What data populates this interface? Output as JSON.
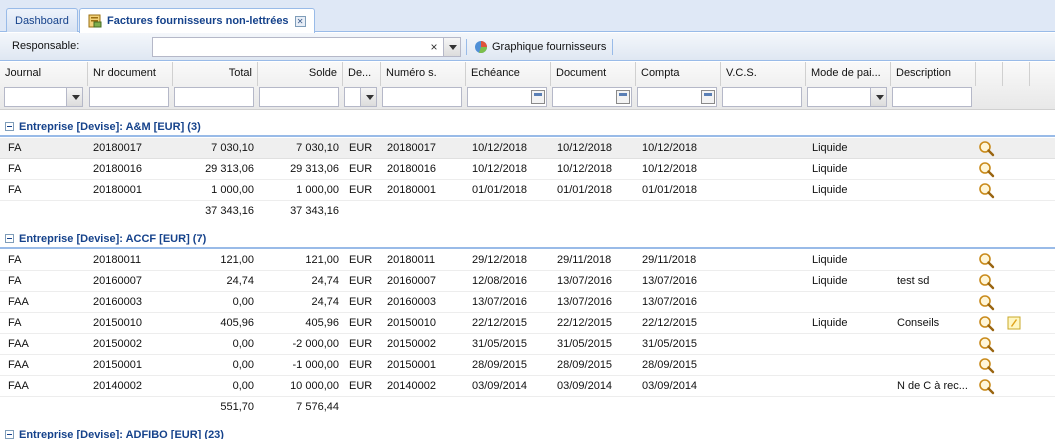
{
  "tabs": [
    {
      "label": "Dashboard",
      "active": false
    },
    {
      "label": "Factures fournisseurs non-lettrées",
      "active": true
    }
  ],
  "toolbar": {
    "responsable_label": "Responsable:",
    "responsable_value": "",
    "clear_glyph": "×",
    "graph_button_label": "Graphique fournisseurs"
  },
  "columns": [
    "Journal",
    "Nr document",
    "Total",
    "Solde",
    "De...",
    "Numéro s.",
    "Echéance",
    "Document",
    "Compta",
    "V.C.S.",
    "Mode de pai...",
    "Description"
  ],
  "groups": [
    {
      "label": "Entreprise [Devise]: A&M [EUR] (3)",
      "rows": [
        {
          "journal": "FA",
          "nr": "20180017",
          "total": "7 030,10",
          "solde": "7 030,10",
          "devise": "EUR",
          "numero": "20180017",
          "echeance": "10/12/2018",
          "document": "10/12/2018",
          "compta": "10/12/2018",
          "vcs": "",
          "mode": "Liquide",
          "description": "",
          "note": false
        },
        {
          "journal": "FA",
          "nr": "20180016",
          "total": "29 313,06",
          "solde": "29 313,06",
          "devise": "EUR",
          "numero": "20180016",
          "echeance": "10/12/2018",
          "document": "10/12/2018",
          "compta": "10/12/2018",
          "vcs": "",
          "mode": "Liquide",
          "description": "",
          "note": false
        },
        {
          "journal": "FA",
          "nr": "20180001",
          "total": "1 000,00",
          "solde": "1 000,00",
          "devise": "EUR",
          "numero": "20180001",
          "echeance": "01/01/2018",
          "document": "01/01/2018",
          "compta": "01/01/2018",
          "vcs": "",
          "mode": "Liquide",
          "description": "",
          "note": false
        }
      ],
      "sum_total": "37 343,16",
      "sum_solde": "37 343,16"
    },
    {
      "label": "Entreprise [Devise]: ACCF [EUR] (7)",
      "rows": [
        {
          "journal": "FA",
          "nr": "20180011",
          "total": "121,00",
          "solde": "121,00",
          "devise": "EUR",
          "numero": "20180011",
          "echeance": "29/12/2018",
          "document": "29/11/2018",
          "compta": "29/11/2018",
          "vcs": "",
          "mode": "Liquide",
          "description": "",
          "note": false
        },
        {
          "journal": "FA",
          "nr": "20160007",
          "total": "24,74",
          "solde": "24,74",
          "devise": "EUR",
          "numero": "20160007",
          "echeance": "12/08/2016",
          "document": "13/07/2016",
          "compta": "13/07/2016",
          "vcs": "",
          "mode": "Liquide",
          "description": "test sd",
          "note": false
        },
        {
          "journal": "FAA",
          "nr": "20160003",
          "total": "0,00",
          "solde": "24,74",
          "devise": "EUR",
          "numero": "20160003",
          "echeance": "13/07/2016",
          "document": "13/07/2016",
          "compta": "13/07/2016",
          "vcs": "",
          "mode": "",
          "description": "",
          "note": false
        },
        {
          "journal": "FA",
          "nr": "20150010",
          "total": "405,96",
          "solde": "405,96",
          "devise": "EUR",
          "numero": "20150010",
          "echeance": "22/12/2015",
          "document": "22/12/2015",
          "compta": "22/12/2015",
          "vcs": "",
          "mode": "Liquide",
          "description": "Conseils",
          "note": true
        },
        {
          "journal": "FAA",
          "nr": "20150002",
          "total": "0,00",
          "solde": "-2 000,00",
          "devise": "EUR",
          "numero": "20150002",
          "echeance": "31/05/2015",
          "document": "31/05/2015",
          "compta": "31/05/2015",
          "vcs": "",
          "mode": "",
          "description": "",
          "note": false
        },
        {
          "journal": "FAA",
          "nr": "20150001",
          "total": "0,00",
          "solde": "-1 000,00",
          "devise": "EUR",
          "numero": "20150001",
          "echeance": "28/09/2015",
          "document": "28/09/2015",
          "compta": "28/09/2015",
          "vcs": "",
          "mode": "",
          "description": "",
          "note": false
        },
        {
          "journal": "FAA",
          "nr": "20140002",
          "total": "0,00",
          "solde": "10 000,00",
          "devise": "EUR",
          "numero": "20140002",
          "echeance": "03/09/2014",
          "document": "03/09/2014",
          "compta": "03/09/2014",
          "vcs": "",
          "mode": "",
          "description": "N de C à rec...",
          "note": false
        }
      ],
      "sum_total": "551,70",
      "sum_solde": "7 576,44"
    },
    {
      "label": "Entreprise [Devise]: ADFIBO [EUR] (23)",
      "rows": [],
      "sum_total": "",
      "sum_solde": ""
    }
  ],
  "colors": {
    "header_blue": "#15428b",
    "border_blue": "#99bbe8"
  }
}
